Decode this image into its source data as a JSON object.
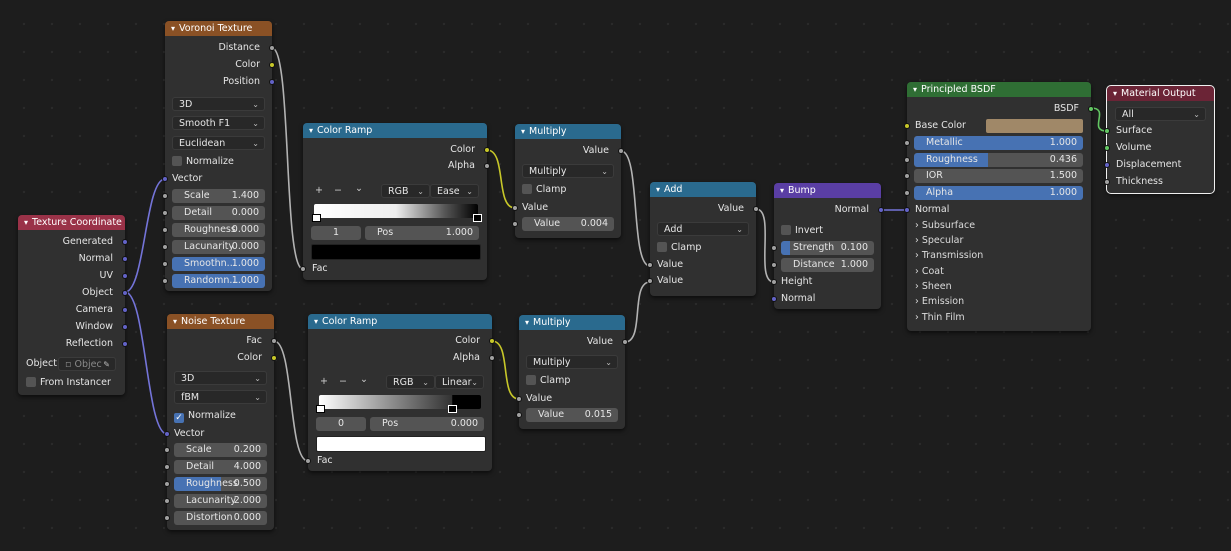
{
  "texcoord": {
    "title": "Texture Coordinate",
    "outputs": [
      "Generated",
      "Normal",
      "UV",
      "Object",
      "Camera",
      "Window",
      "Reflection"
    ],
    "object_label": "Object:",
    "object_placeholder": "Objec",
    "from_instancer": "From Instancer"
  },
  "voronoi": {
    "title": "Voronoi Texture",
    "outputs": [
      "Distance",
      "Color",
      "Position"
    ],
    "dim": "3D",
    "feature": "Smooth F1",
    "metric": "Euclidean",
    "normalize": "Normalize",
    "vector": "Vector",
    "fields": [
      {
        "label": "Scale",
        "value": "1.400",
        "fill": 0
      },
      {
        "label": "Detail",
        "value": "0.000",
        "fill": 0
      },
      {
        "label": "Roughness",
        "value": "0.000",
        "fill": 0
      },
      {
        "label": "Lacunarity",
        "value": "0.000",
        "fill": 0
      },
      {
        "label": "Smoothn...",
        "value": "1.000",
        "fill": 1
      },
      {
        "label": "Randomn...",
        "value": "1.000",
        "fill": 1
      }
    ]
  },
  "noise": {
    "title": "Noise Texture",
    "outputs": [
      "Fac",
      "Color"
    ],
    "dim": "3D",
    "type": "fBM",
    "normalize": "Normalize",
    "vector": "Vector",
    "fields": [
      {
        "label": "Scale",
        "value": "0.200",
        "fill": 0
      },
      {
        "label": "Detail",
        "value": "4.000",
        "fill": 0
      },
      {
        "label": "Roughness",
        "value": "0.500",
        "fill": 0.5
      },
      {
        "label": "Lacunarity",
        "value": "2.000",
        "fill": 0
      },
      {
        "label": "Distortion",
        "value": "0.000",
        "fill": 0
      }
    ]
  },
  "ramp1": {
    "title": "Color Ramp",
    "outputs": [
      "Color",
      "Alpha"
    ],
    "tools": [
      "+",
      "−",
      "⌄"
    ],
    "mode": "RGB",
    "interp": "Ease",
    "index": "1",
    "pos_label": "Pos",
    "pos_value": "1.000",
    "input": "Fac",
    "swatch_color": "#000000"
  },
  "ramp2": {
    "title": "Color Ramp",
    "outputs": [
      "Color",
      "Alpha"
    ],
    "tools": [
      "+",
      "−",
      "⌄"
    ],
    "mode": "RGB",
    "interp": "Linear",
    "index": "0",
    "pos_label": "Pos",
    "pos_value": "0.000",
    "input": "Fac",
    "swatch_color": "#ffffff"
  },
  "mult1": {
    "title": "Multiply",
    "output": "Value",
    "op": "Multiply",
    "clamp": "Clamp",
    "input": "Value",
    "field_label": "Value",
    "field_value": "0.004"
  },
  "mult2": {
    "title": "Multiply",
    "output": "Value",
    "op": "Multiply",
    "clamp": "Clamp",
    "input": "Value",
    "field_label": "Value",
    "field_value": "0.015"
  },
  "add": {
    "title": "Add",
    "output": "Value",
    "op": "Add",
    "clamp": "Clamp",
    "inputs": [
      "Value",
      "Value"
    ]
  },
  "bump": {
    "title": "Bump",
    "output": "Normal",
    "invert": "Invert",
    "strength_label": "Strength",
    "strength_value": "0.100",
    "strength_fill": 0.1,
    "distance_label": "Distance",
    "distance_value": "1.000",
    "inputs": [
      "Height",
      "Normal"
    ]
  },
  "bsdf": {
    "title": "Principled BSDF",
    "output": "BSDF",
    "base_color_label": "Base Color",
    "base_color": "#a08868",
    "fields": [
      {
        "label": "Metallic",
        "value": "1.000",
        "fill": 1
      },
      {
        "label": "Roughness",
        "value": "0.436",
        "fill": 0.436
      },
      {
        "label": "IOR",
        "value": "1.500",
        "fill": 0
      },
      {
        "label": "Alpha",
        "value": "1.000",
        "fill": 1
      }
    ],
    "normal": "Normal",
    "panels": [
      "Subsurface",
      "Specular",
      "Transmission",
      "Coat",
      "Sheen",
      "Emission",
      "Thin Film"
    ]
  },
  "matout": {
    "title": "Material Output",
    "target": "All",
    "inputs": [
      "Surface",
      "Volume",
      "Displacement",
      "Thickness"
    ]
  },
  "colors": {
    "accent": "#4772b3",
    "wire": "#b3b3b3",
    "vector_wire": "#7474d9",
    "color_wire": "#c7c729",
    "shader_wire": "#63c763"
  }
}
